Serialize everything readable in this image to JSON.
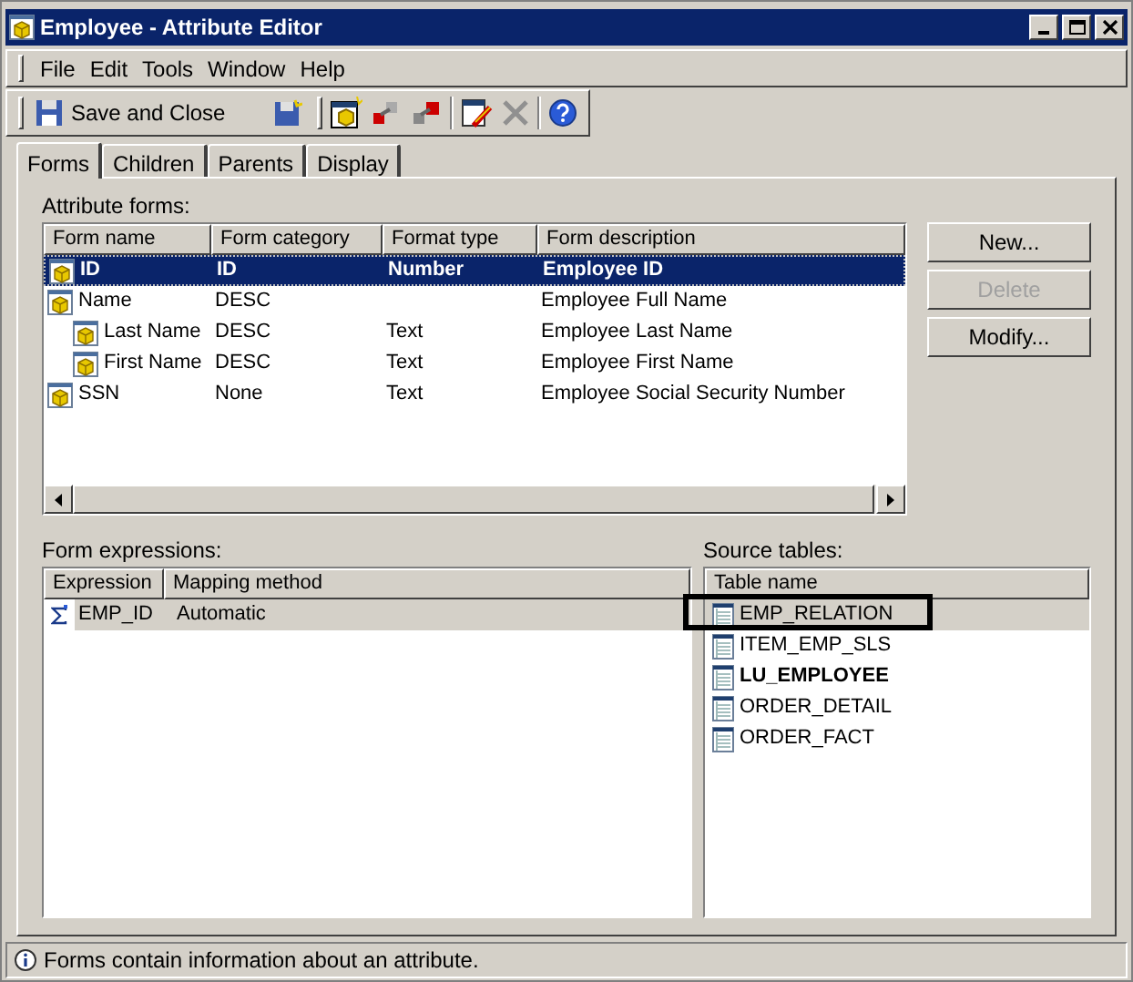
{
  "window": {
    "title": "Employee - Attribute Editor"
  },
  "menu": [
    "File",
    "Edit",
    "Tools",
    "Window",
    "Help"
  ],
  "toolbar": {
    "save_label": "Save and Close"
  },
  "tabs": [
    {
      "label": "Forms",
      "selected": true
    },
    {
      "label": "Children",
      "selected": false
    },
    {
      "label": "Parents",
      "selected": false
    },
    {
      "label": "Display",
      "selected": false
    }
  ],
  "attribute_forms": {
    "label": "Attribute forms:",
    "columns": [
      "Form name",
      "Form category",
      "Format type",
      "Form description"
    ],
    "rows": [
      {
        "name": "ID",
        "category": "ID",
        "format": "Number",
        "description": "Employee ID",
        "selected": true,
        "emphasized": true
      },
      {
        "name": "Name",
        "category": "DESC",
        "format": "",
        "description": "Employee Full Name",
        "selected": false,
        "emphasized": false,
        "children": [
          {
            "name": "Last Name",
            "category": "DESC",
            "format": "Text",
            "description": "Employee Last Name",
            "selected": false,
            "emphasized": false
          },
          {
            "name": "First Name",
            "category": "DESC",
            "format": "Text",
            "description": "Employee First Name",
            "selected": false,
            "emphasized": false
          }
        ]
      },
      {
        "name": "SSN",
        "category": "None",
        "format": "Text",
        "description": "Employee Social Security Number",
        "selected": false,
        "emphasized": false
      }
    ]
  },
  "buttons": [
    {
      "label": "New...",
      "disabled": false
    },
    {
      "label": "Delete",
      "disabled": true
    },
    {
      "label": "Modify...",
      "disabled": false
    }
  ],
  "form_expressions": {
    "label": "Form expressions:",
    "columns": [
      "Expression",
      "Mapping method"
    ],
    "rows": [
      {
        "expression": "EMP_ID",
        "mapping": "Automatic",
        "selected": true
      }
    ]
  },
  "source_tables": {
    "label": "Source tables:",
    "column": "Table name",
    "rows": [
      {
        "name": "EMP_RELATION",
        "selected": true,
        "emphasized": false,
        "highlighted": true
      },
      {
        "name": "ITEM_EMP_SLS",
        "selected": false,
        "emphasized": false,
        "highlighted": false
      },
      {
        "name": "LU_EMPLOYEE",
        "selected": false,
        "emphasized": true,
        "highlighted": false
      },
      {
        "name": "ORDER_DETAIL",
        "selected": false,
        "emphasized": false,
        "highlighted": false
      },
      {
        "name": "ORDER_FACT",
        "selected": false,
        "emphasized": false,
        "highlighted": false
      }
    ]
  },
  "status_bar": {
    "text": "Forms contain information about an attribute."
  }
}
